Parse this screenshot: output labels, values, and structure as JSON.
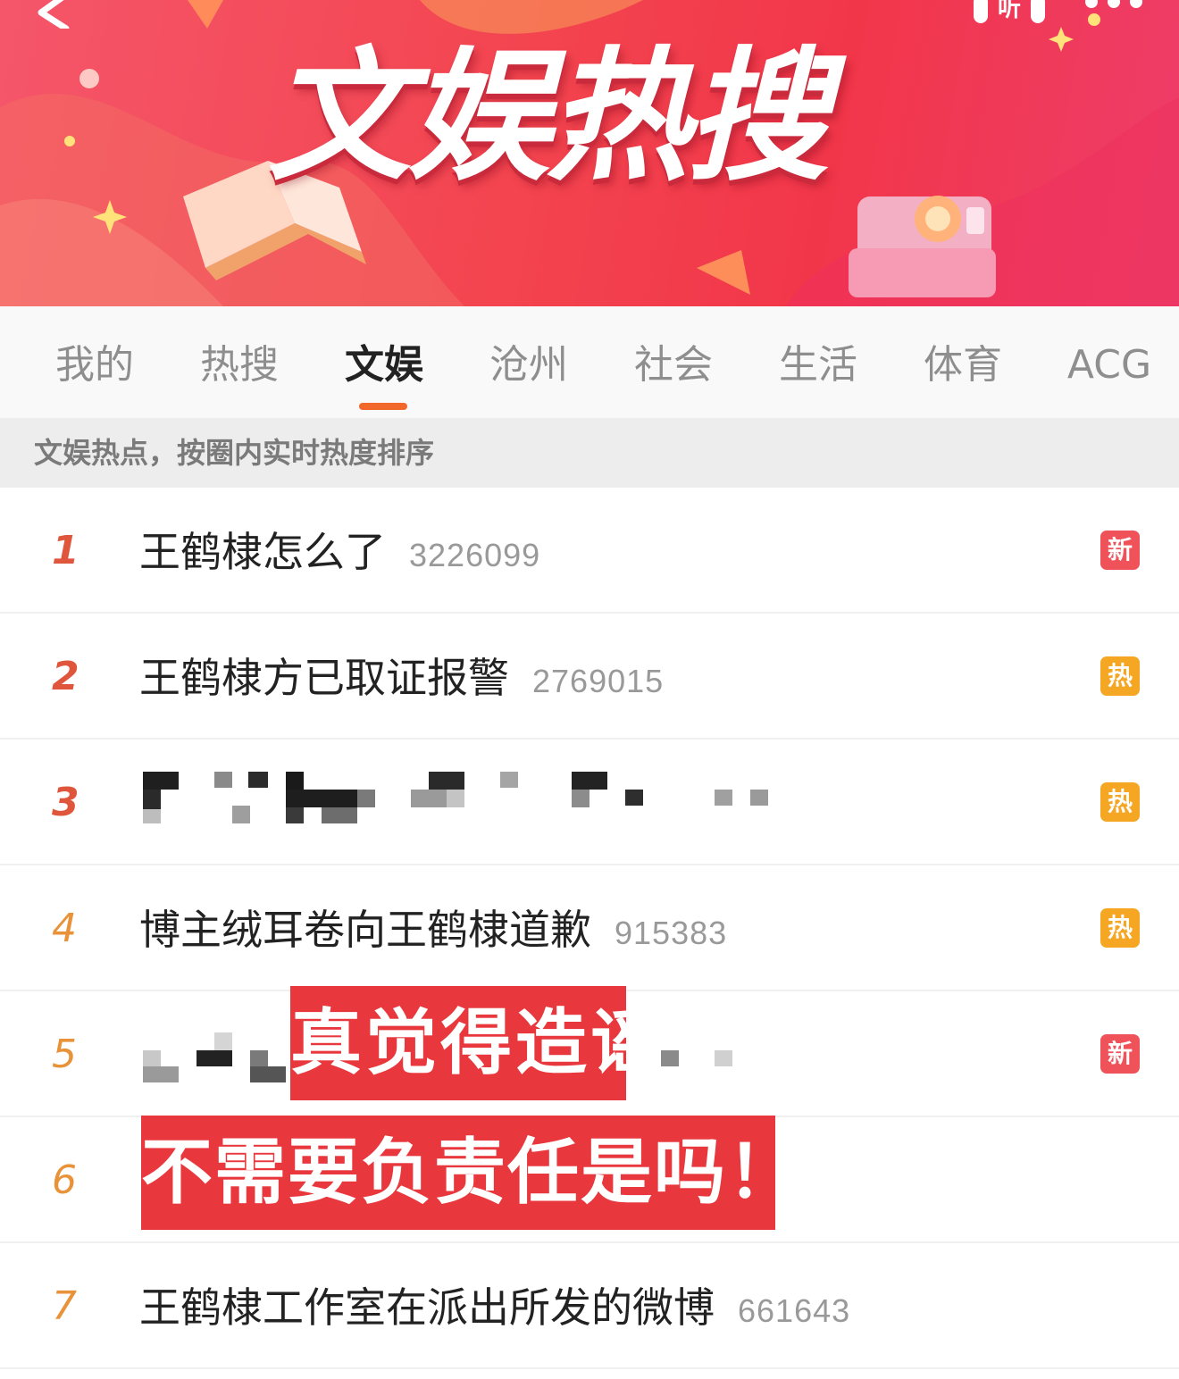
{
  "banner": {
    "title": "文娱热搜",
    "listen_label": "听",
    "colors": {
      "background": "#f3444f",
      "accent": "#f2672a"
    },
    "icons": [
      "back-icon",
      "listen-icon",
      "more-icon",
      "book-icon",
      "camera-icon"
    ]
  },
  "tabs": [
    {
      "label": "我的",
      "active": false
    },
    {
      "label": "热搜",
      "active": false
    },
    {
      "label": "文娱",
      "active": true
    },
    {
      "label": "沧州",
      "active": false
    },
    {
      "label": "社会",
      "active": false
    },
    {
      "label": "生活",
      "active": false
    },
    {
      "label": "体育",
      "active": false
    },
    {
      "label": "ACG",
      "active": false
    }
  ],
  "subtitle": "文娱热点，按圈内实时热度排序",
  "rows": [
    {
      "rank": "1",
      "title": "王鹤棣怎么了",
      "count": "3226099",
      "badge": "新",
      "badge_type": "new"
    },
    {
      "rank": "2",
      "title": "王鹤棣方已取证报警",
      "count": "2769015",
      "badge": "热",
      "badge_type": "hot"
    },
    {
      "rank": "3",
      "title": "",
      "count": "",
      "badge": "热",
      "badge_type": "hot",
      "pixelated": true
    },
    {
      "rank": "4",
      "title": "博主绒耳卷向王鹤棣道歉",
      "count": "915383",
      "badge": "热",
      "badge_type": "hot"
    },
    {
      "rank": "5",
      "title": "",
      "count": "",
      "badge": "新",
      "badge_type": "new",
      "pixelated": true
    },
    {
      "rank": "6",
      "title": "",
      "count": "",
      "badge": "",
      "badge_type": ""
    },
    {
      "rank": "7",
      "title": "王鹤棣工作室在派出所发的微博",
      "count": "661643",
      "badge": "",
      "badge_type": ""
    }
  ],
  "overlay_captions": {
    "line1": "真觉得造谣",
    "line2": "不需要负责任是吗！？",
    "color": "#e8383d"
  }
}
